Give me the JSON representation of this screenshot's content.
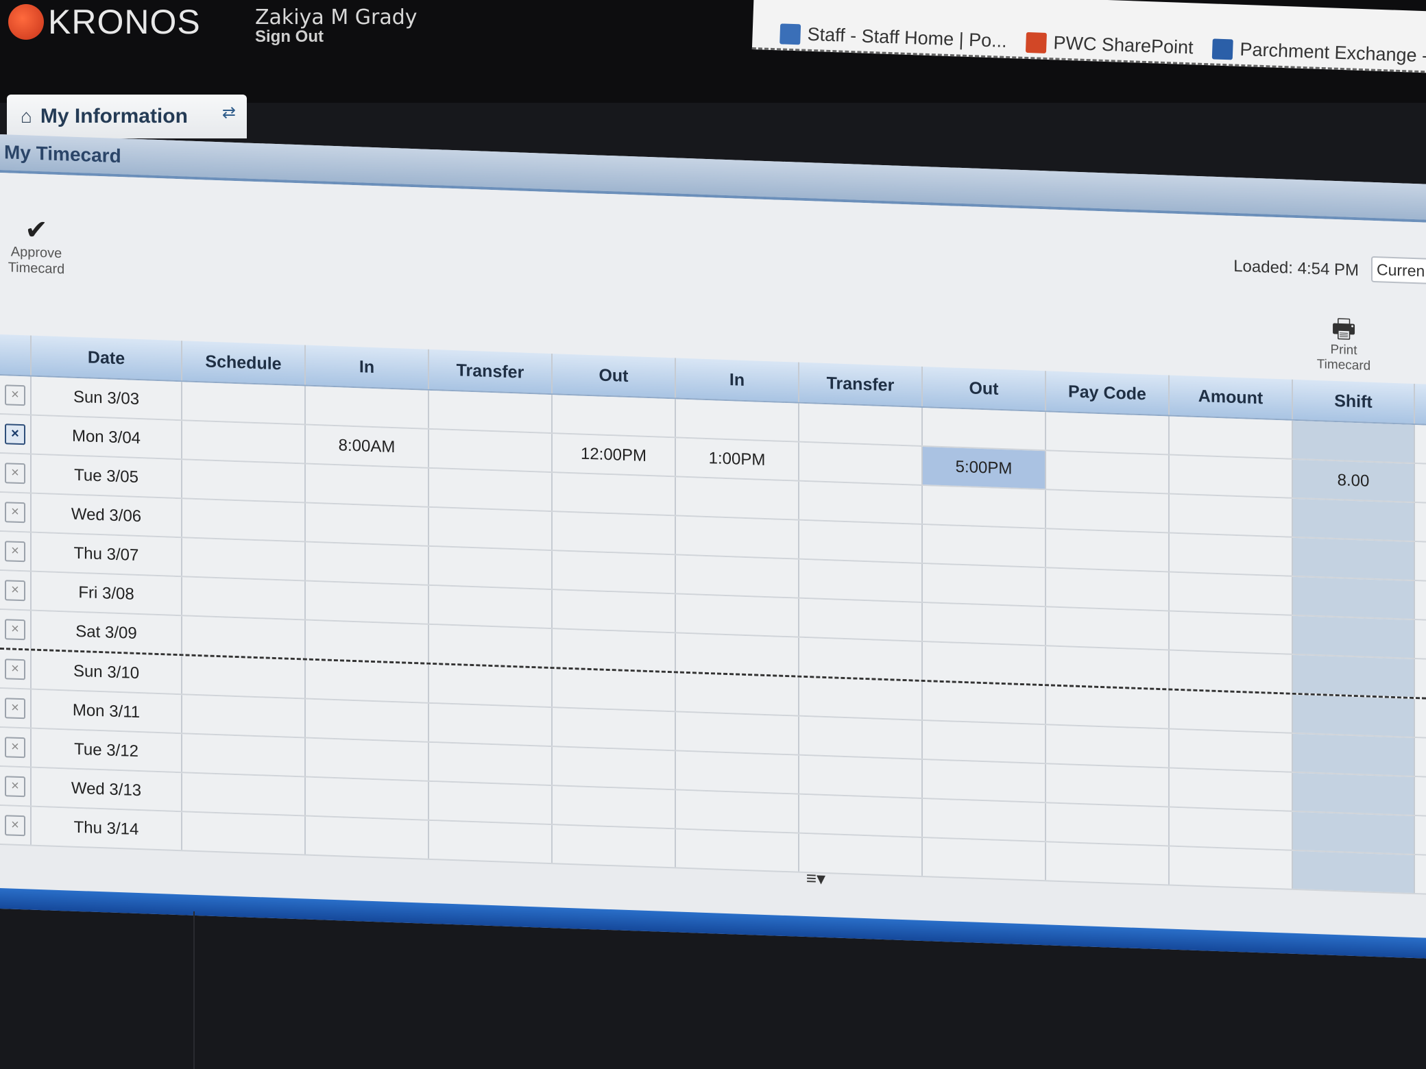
{
  "header": {
    "brand": "KRONOS",
    "user_name": "Zakiya M Grady",
    "sign_out": "Sign Out",
    "bookmarks": [
      {
        "label": "Staff - Staff Home | Po...",
        "icon": "shield-icon",
        "color": "#3a6fb8"
      },
      {
        "label": "PWC SharePoint",
        "icon": "sharepoint-icon",
        "color": "#d24726"
      },
      {
        "label": "Parchment Exchange -...",
        "icon": "parchment-icon",
        "color": "#2b5fa8"
      }
    ]
  },
  "tab": {
    "label": "My Information",
    "home_icon": "home-icon",
    "refresh_icon": "refresh-icon"
  },
  "panel": {
    "title": "My Timecard"
  },
  "toolbar": {
    "approve_label": "Approve Timecard",
    "loaded_label": "Loaded: 4:54 PM",
    "current_select": "Curren",
    "print_label": "Print Timecard"
  },
  "grid": {
    "columns": [
      "Date",
      "Schedule",
      "In",
      "Transfer",
      "Out",
      "In",
      "Transfer",
      "Out",
      "Pay Code",
      "Amount",
      "Shift"
    ],
    "rows": [
      {
        "date": "Sun 3/03",
        "checked": false,
        "cells": [
          "",
          "",
          "",
          "",
          "",
          "",
          "",
          "",
          "",
          ""
        ]
      },
      {
        "date": "Mon 3/04",
        "checked": true,
        "cells": [
          "",
          "8:00AM",
          "",
          "12:00PM",
          "1:00PM",
          "",
          "5:00PM",
          "",
          "",
          "8.00"
        ]
      },
      {
        "date": "Tue 3/05",
        "checked": false,
        "cells": [
          "",
          "",
          "",
          "",
          "",
          "",
          "",
          "",
          "",
          ""
        ]
      },
      {
        "date": "Wed 3/06",
        "checked": false,
        "cells": [
          "",
          "",
          "",
          "",
          "",
          "",
          "",
          "",
          "",
          ""
        ]
      },
      {
        "date": "Thu 3/07",
        "checked": false,
        "cells": [
          "",
          "",
          "",
          "",
          "",
          "",
          "",
          "",
          "",
          ""
        ]
      },
      {
        "date": "Fri 3/08",
        "checked": false,
        "cells": [
          "",
          "",
          "",
          "",
          "",
          "",
          "",
          "",
          "",
          ""
        ]
      },
      {
        "date": "Sat 3/09",
        "checked": false,
        "cells": [
          "",
          "",
          "",
          "",
          "",
          "",
          "",
          "",
          "",
          ""
        ]
      },
      {
        "date": "Sun 3/10",
        "checked": false,
        "cells": [
          "",
          "",
          "",
          "",
          "",
          "",
          "",
          "",
          "",
          ""
        ]
      },
      {
        "date": "Mon 3/11",
        "checked": false,
        "cells": [
          "",
          "",
          "",
          "",
          "",
          "",
          "",
          "",
          "",
          ""
        ]
      },
      {
        "date": "Tue 3/12",
        "checked": false,
        "cells": [
          "",
          "",
          "",
          "",
          "",
          "",
          "",
          "",
          "",
          ""
        ]
      },
      {
        "date": "Wed 3/13",
        "checked": false,
        "cells": [
          "",
          "",
          "",
          "",
          "",
          "",
          "",
          "",
          "",
          ""
        ]
      },
      {
        "date": "Thu 3/14",
        "checked": false,
        "cells": [
          "",
          "",
          "",
          "",
          "",
          "",
          "",
          "",
          "",
          ""
        ]
      }
    ]
  }
}
